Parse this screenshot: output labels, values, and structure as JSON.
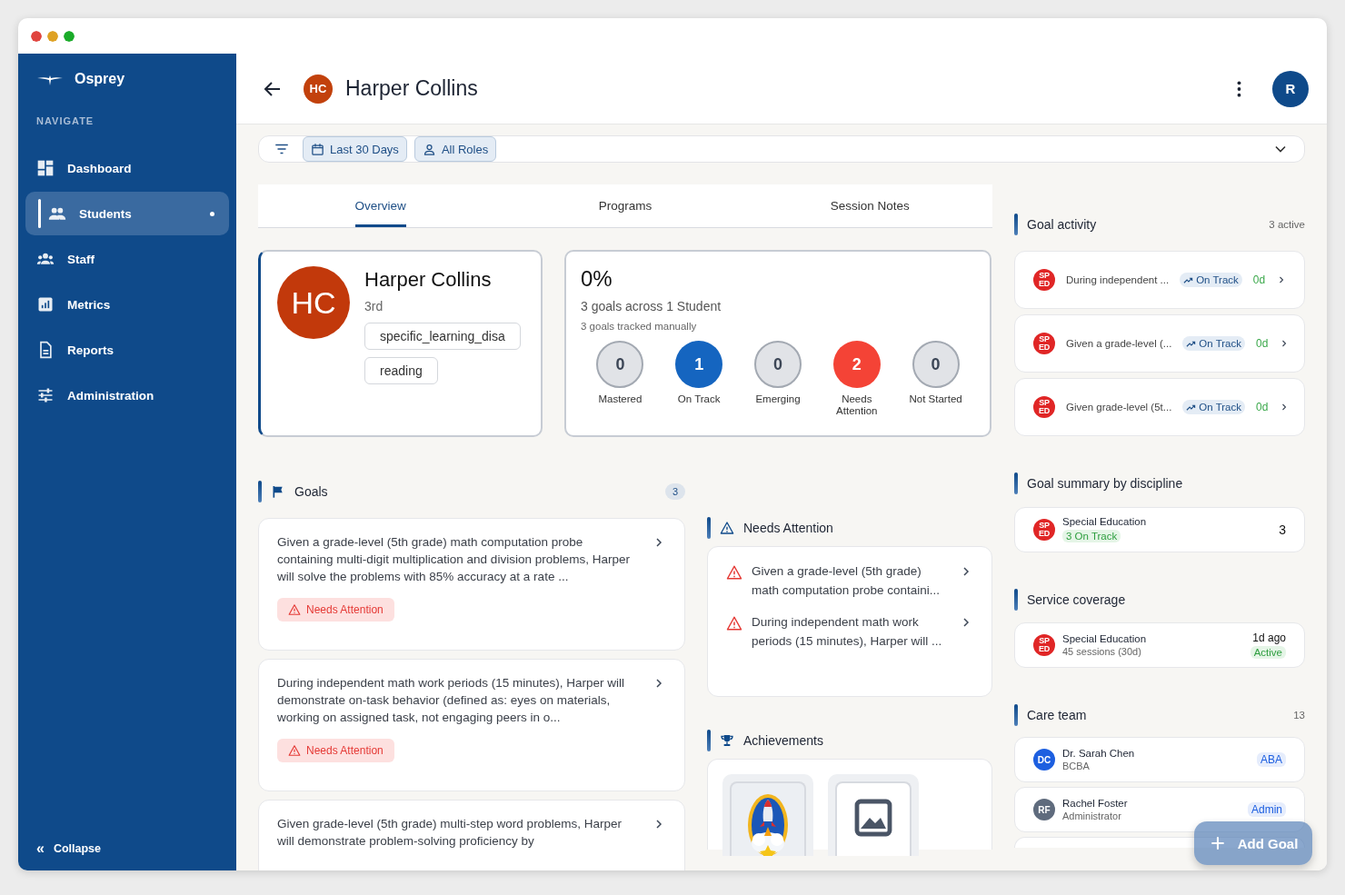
{
  "sidebar": {
    "brand": "Osprey",
    "section": "NAVIGATE",
    "items": [
      {
        "label": "Dashboard",
        "kind": "dashboard",
        "selected": false
      },
      {
        "label": "Students",
        "kind": "people",
        "selected": true
      },
      {
        "label": "Staff",
        "kind": "group",
        "selected": false
      },
      {
        "label": "Metrics",
        "kind": "chart",
        "selected": false
      },
      {
        "label": "Reports",
        "kind": "document",
        "selected": false
      },
      {
        "label": "Administration",
        "kind": "sliders",
        "selected": false
      }
    ],
    "collapse": {
      "icon": "«",
      "label": "Collapse"
    }
  },
  "header": {
    "avatar": "HC",
    "title": "Harper Collins",
    "user_avatar": "R"
  },
  "filters": [
    {
      "kind": "calendar",
      "label": "Last 30 Days"
    },
    {
      "kind": "person",
      "label": "All Roles"
    }
  ],
  "tabs": [
    {
      "label": "Overview",
      "selected": true
    },
    {
      "label": "Programs",
      "selected": false
    },
    {
      "label": "Session Notes",
      "selected": false
    }
  ],
  "profile": {
    "avatar": "HC",
    "name": "Harper Collins",
    "grade": "3rd",
    "tags": [
      "specific_learning_disa",
      "reading"
    ]
  },
  "summary": {
    "percent": "0%",
    "subtitle": "3 goals across 1 Student",
    "note": "3 goals tracked manually",
    "statuses": [
      {
        "count": "0",
        "label": "Mastered",
        "color": "#e1e3e7"
      },
      {
        "count": "1",
        "label": "On Track",
        "color": "#1565c0"
      },
      {
        "count": "0",
        "label": "Emerging",
        "color": "#e1e3e7"
      },
      {
        "count": "2",
        "label": "Needs Attention",
        "color": "#f44336"
      },
      {
        "count": "0",
        "label": "Not Started",
        "color": "#e1e3e7"
      }
    ]
  },
  "goals": {
    "title": "Goals",
    "count": "3",
    "items": [
      {
        "text": "Given a grade-level (5th grade) math computation probe containing multi-digit multiplication and division problems, Harper will solve the problems with 85% accuracy at a rate ...",
        "status": "Needs Attention"
      },
      {
        "text": "During independent math work periods (15 minutes), Harper will demonstrate on-task behavior (defined as: eyes on materials, working on assigned task, not engaging peers in o...",
        "status": "Needs Attention"
      },
      {
        "text": "Given grade-level (5th grade) multi-step word problems, Harper will demonstrate problem-solving proficiency by"
      }
    ]
  },
  "needs_attention": {
    "title": "Needs Attention",
    "items": [
      "Given a grade-level (5th grade) math computation probe containi...",
      "During independent math work periods (15 minutes), Harper will ..."
    ]
  },
  "achievements": {
    "title": "Achievements",
    "items": [
      {
        "kind": "picture"
      },
      {
        "kind": "placeholder"
      }
    ]
  },
  "goal_activity": {
    "title": "Goal activity",
    "count": "3 active",
    "items": [
      {
        "badge": "SPED",
        "text": "During independent ...",
        "status": "On Track",
        "age": "0d"
      },
      {
        "badge": "SPED",
        "text": "Given a grade-level (...",
        "status": "On Track",
        "age": "0d"
      },
      {
        "badge": "SPED",
        "text": "Given grade-level (5t...",
        "status": "On Track",
        "age": "0d"
      }
    ]
  },
  "discipline_summary": {
    "title": "Goal summary by discipline",
    "items": [
      {
        "badge": "SPED",
        "name": "Special Education",
        "status": "3 On Track",
        "count": "3"
      }
    ]
  },
  "service_coverage": {
    "title": "Service coverage",
    "items": [
      {
        "badge": "SPED",
        "name": "Special Education",
        "detail": "45 sessions (30d)",
        "time": "1d ago",
        "status": "Active"
      }
    ]
  },
  "care_team": {
    "title": "Care team",
    "count": "13",
    "members": [
      {
        "initials": "DC",
        "name": "Dr. Sarah Chen",
        "role": "BCBA",
        "tag": "ABA",
        "color": "#1d5fe0"
      },
      {
        "initials": "RF",
        "name": "Rachel Foster",
        "role": "Administrator",
        "tag": "Admin",
        "color": "#5f6b7d"
      }
    ]
  },
  "fab": {
    "label": "Add Goal"
  }
}
